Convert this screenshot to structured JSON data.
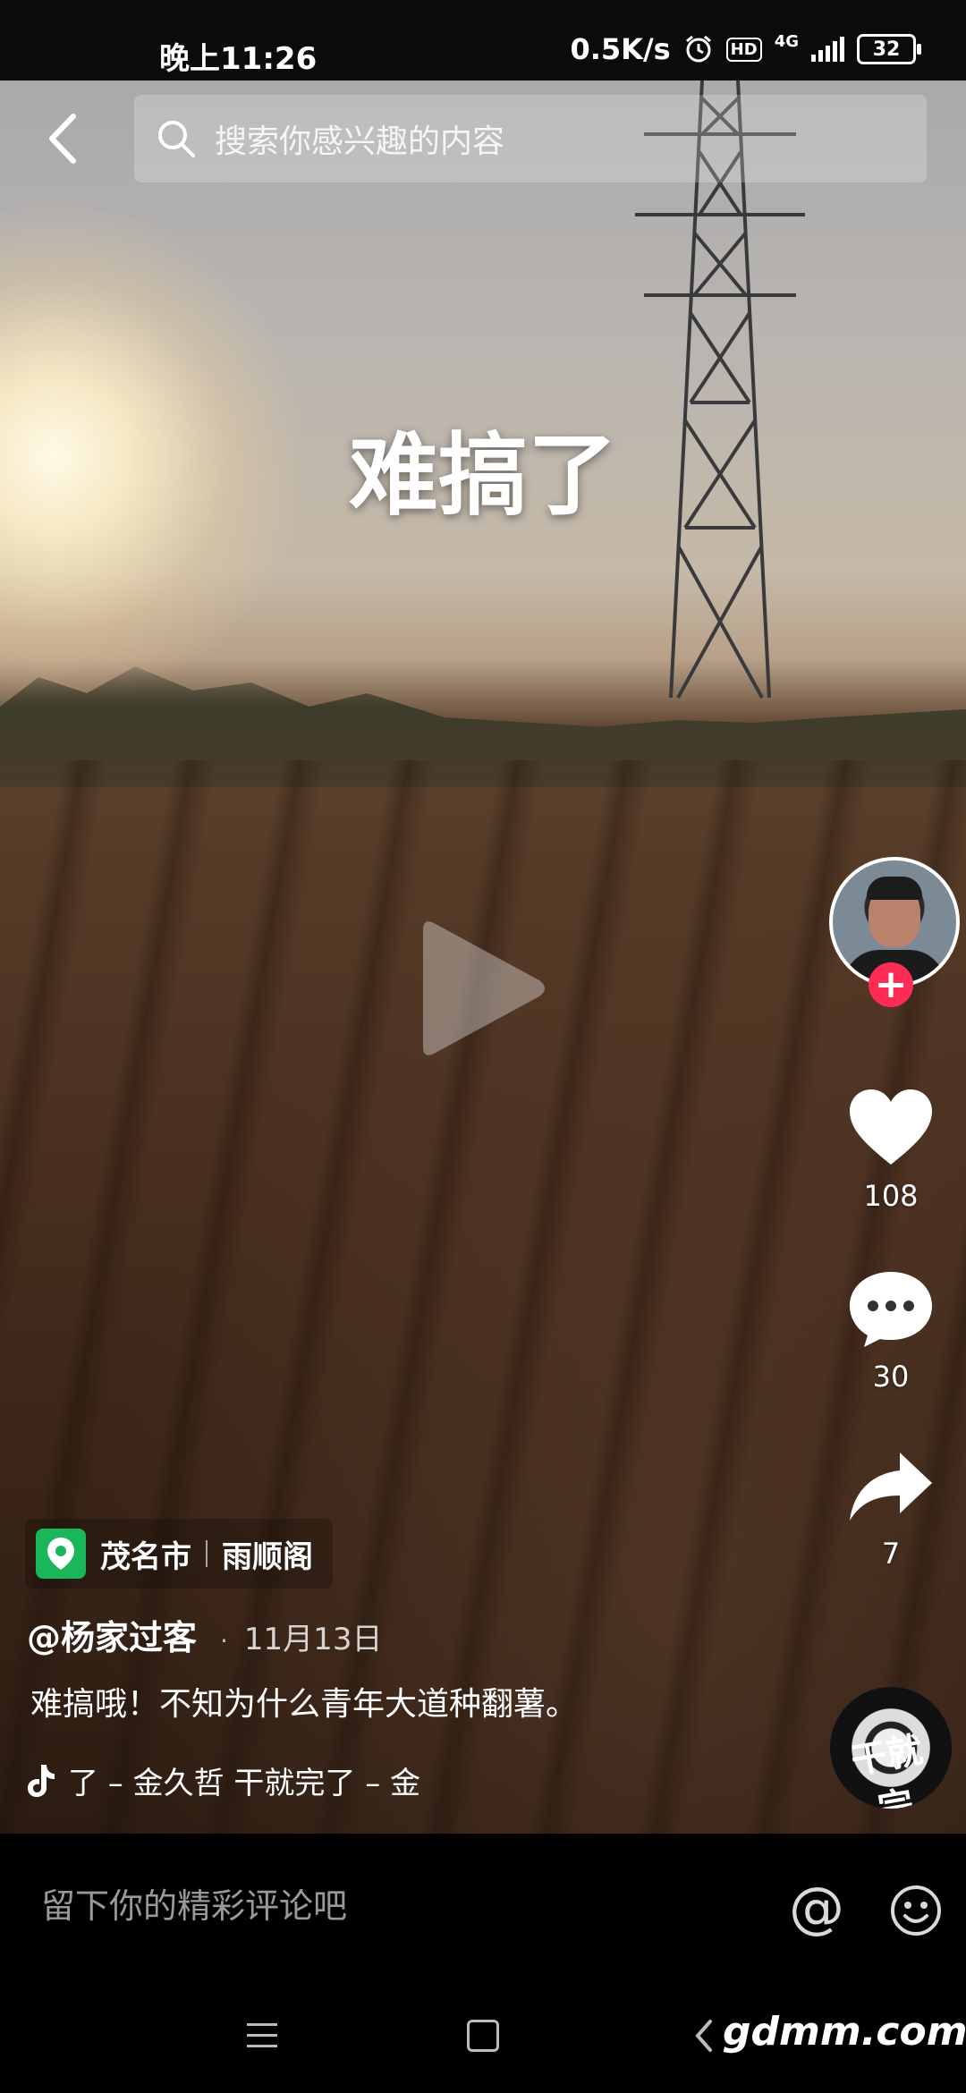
{
  "status_bar": {
    "time": "晚上11:26",
    "net_speed": "0.5K/s",
    "hd_badge": "HD",
    "network_type": "4G",
    "battery": "32"
  },
  "search": {
    "placeholder": "搜索你感兴趣的内容"
  },
  "video": {
    "overlay_caption": "难搞了"
  },
  "sidebar": {
    "follow_symbol": "+",
    "likes": "108",
    "comments": "30",
    "shares": "7",
    "music_disc_text": "干就完"
  },
  "info": {
    "location_city": "茂名市",
    "location_place": "雨顺阁",
    "author": "@杨家过客",
    "separator": "·",
    "date": "11月13日",
    "description": "难搞哦！不知为什么青年大道种翻薯。",
    "music_ticker": "了 – 金久哲    干就完了 – 金"
  },
  "comment_bar": {
    "placeholder": "留下你的精彩评论吧",
    "at_symbol": "@"
  },
  "watermark": "gdmm.com",
  "colors": {
    "follow_red": "#fe2c55",
    "location_green": "#19b75a"
  }
}
